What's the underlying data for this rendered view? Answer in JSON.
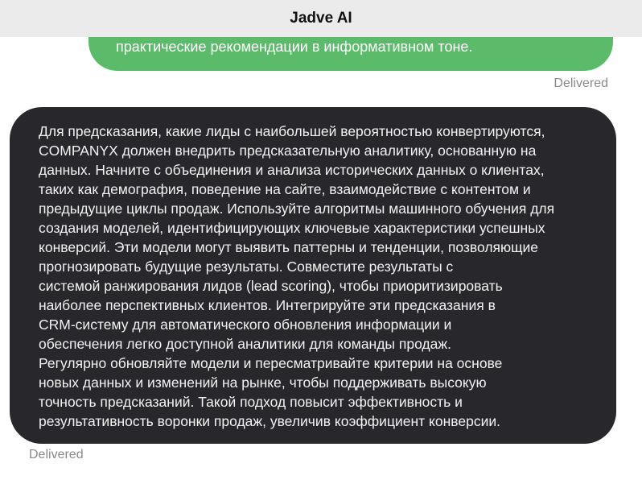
{
  "header": {
    "title": "Jadve AI"
  },
  "messages": {
    "outgoing": {
      "text_visible": "практические рекомендации в информативном тоне.",
      "status": "Delivered"
    },
    "incoming": {
      "lines": [
        "Для предсказания, какие лиды с наибольшей вероятностью конвертируются,",
        "COMPANYX должен внедрить предсказательную аналитику, основанную на",
        "данных. Начните с объединения и анализа исторических данных о клиентах,",
        "таких как демография, поведение на сайте, взаимодействие с контентом и",
        "предыдущие циклы продаж. Используйте алгоритмы машинного обучения для",
        "создания моделей, идентифицирующих ключевые характеристики успешных",
        "конверсий. Эти модели могут выявить паттерны и тенденции, позволяющие",
        "прогнозировать будущие результаты. Совместите результаты с",
        "системой ранжирования лидов (lead scoring), чтобы приоритизировать",
        "наиболее перспективных клиентов. Интегрируйте эти предсказания в",
        "CRM-систему для автоматического обновления информации и",
        "обеспечения легко доступной аналитики для команды продаж.",
        "Регулярно обновляйте модели и пересматривайте критерии на основе",
        "новых данных и изменений на рынке, чтобы поддерживать высокую",
        "точность предсказаний. Такой подход повысит эффективность и",
        "результативность воронки продаж, увеличив коэффициент конверсии."
      ],
      "status": "Delivered"
    }
  },
  "colors": {
    "header_bg": "#ebebeb",
    "outgoing_bubble": "#5bbb6a",
    "incoming_bubble": "#28282c",
    "status_text": "#8a8a8a"
  }
}
